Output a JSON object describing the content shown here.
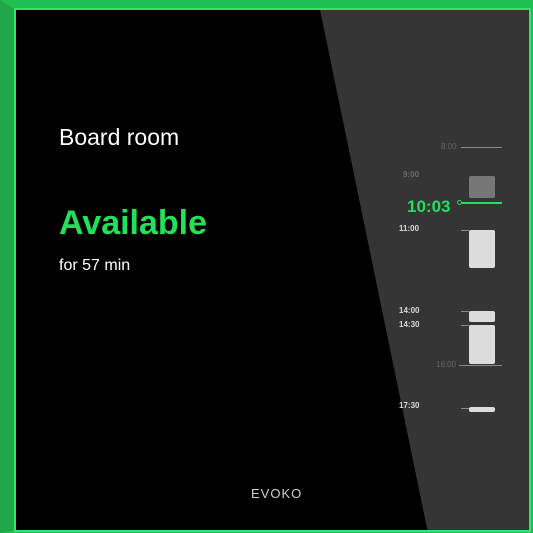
{
  "room": {
    "name": "Board room",
    "status": "Available",
    "duration": "for 57 min"
  },
  "brand": {
    "logo_text": "EVOKO"
  },
  "timeline": {
    "current_time": "10:03",
    "hour_marks": [
      "8:00",
      "16:00"
    ],
    "booking_starts": [
      "9:00",
      "11:00",
      "14:00",
      "14:30",
      "17:30"
    ]
  },
  "colors": {
    "accent": "#22e05a",
    "frame": "#1fbf52",
    "panel": "#353535",
    "background": "#000000"
  }
}
